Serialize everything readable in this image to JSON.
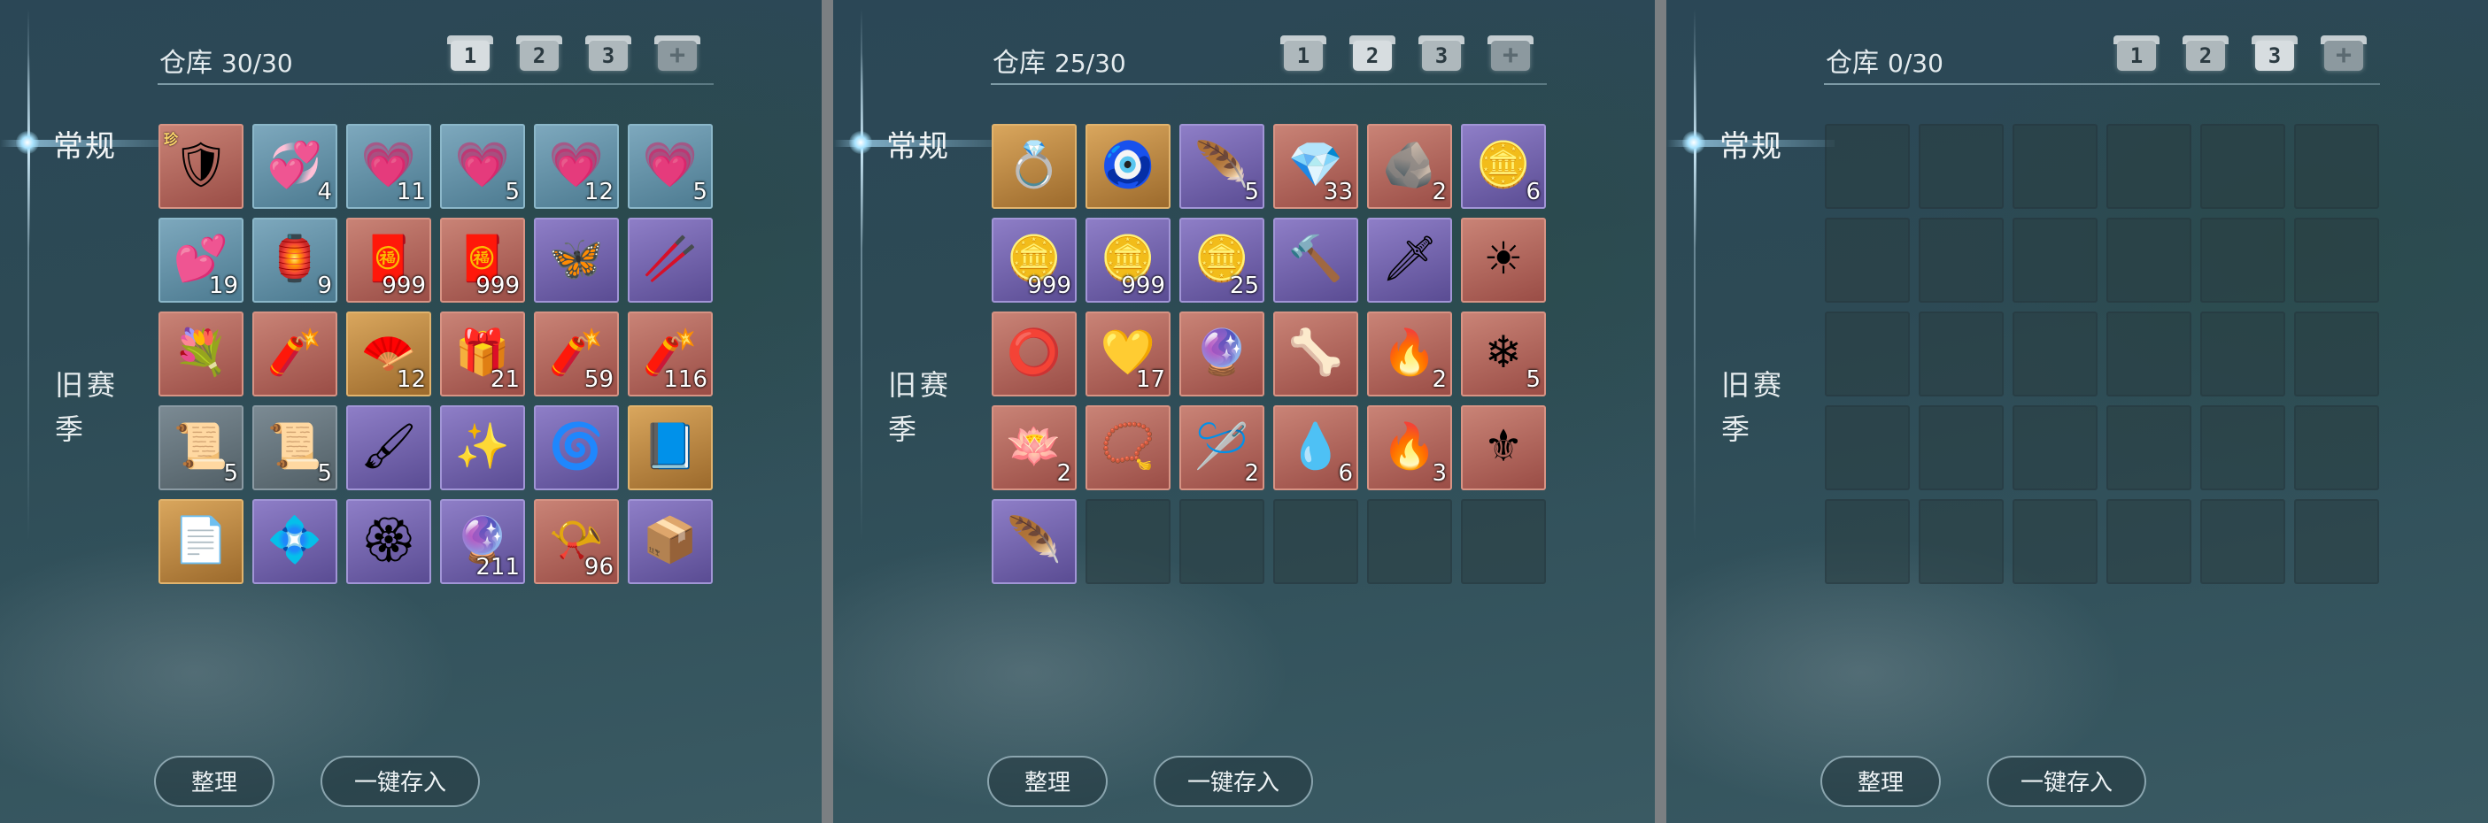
{
  "panels": [
    {
      "title": "仓库",
      "count": "30/30",
      "active_page": 1,
      "pages": [
        "1",
        "2",
        "3",
        "+"
      ],
      "tabs": {
        "general": "常规",
        "old_season": "旧赛季"
      },
      "buttons": {
        "sort": "整理",
        "store_all": "一键存入"
      },
      "slots": [
        {
          "rarity": "red",
          "icon": "armor-icon",
          "glyph": "🛡",
          "qty": "",
          "tag": "珍"
        },
        {
          "rarity": "blue",
          "icon": "sparkle-hearts-icon",
          "glyph": "💞",
          "qty": "4"
        },
        {
          "rarity": "blue",
          "icon": "heart-icon",
          "glyph": "💗",
          "qty": "11"
        },
        {
          "rarity": "blue",
          "icon": "heart-icon",
          "glyph": "💗",
          "qty": "5"
        },
        {
          "rarity": "blue",
          "icon": "heart-icon",
          "glyph": "💗",
          "qty": "12"
        },
        {
          "rarity": "blue",
          "icon": "heart-icon",
          "glyph": "💗",
          "qty": "5"
        },
        {
          "rarity": "blue",
          "icon": "small-hearts-icon",
          "glyph": "💕",
          "qty": "19"
        },
        {
          "rarity": "blue",
          "icon": "lantern-icon",
          "glyph": "🏮",
          "qty": "9"
        },
        {
          "rarity": "red",
          "icon": "gift-box-icon",
          "glyph": "🧧",
          "qty": "999"
        },
        {
          "rarity": "red",
          "icon": "gift-box-icon",
          "glyph": "🧧",
          "qty": "999"
        },
        {
          "rarity": "purple",
          "icon": "butterfly-icon",
          "glyph": "🦋",
          "qty": ""
        },
        {
          "rarity": "purple",
          "icon": "chopsticks-icon",
          "glyph": "🥢",
          "qty": ""
        },
        {
          "rarity": "red",
          "icon": "bouquet-icon",
          "glyph": "💐",
          "qty": ""
        },
        {
          "rarity": "red",
          "icon": "firecracker-icon",
          "glyph": "🧨",
          "qty": ""
        },
        {
          "rarity": "gold",
          "icon": "fan-icon",
          "glyph": "🪭",
          "qty": "12"
        },
        {
          "rarity": "red",
          "icon": "red-chest-icon",
          "glyph": "🎁",
          "qty": "21"
        },
        {
          "rarity": "red",
          "icon": "firecracker-bundle-icon",
          "glyph": "🧨",
          "qty": "59"
        },
        {
          "rarity": "red",
          "icon": "firecracker-roll-icon",
          "glyph": "🧨",
          "qty": "116"
        },
        {
          "rarity": "gray",
          "icon": "scroll-icon",
          "glyph": "📜",
          "qty": "5"
        },
        {
          "rarity": "gray",
          "icon": "scroll-icon",
          "glyph": "📜",
          "qty": "5"
        },
        {
          "rarity": "purple",
          "icon": "brush-icon",
          "glyph": "🖌",
          "qty": ""
        },
        {
          "rarity": "purple",
          "icon": "golden-flower-pin-icon",
          "glyph": "✨",
          "qty": ""
        },
        {
          "rarity": "purple",
          "icon": "purple-swirl-icon",
          "glyph": "🌀",
          "qty": ""
        },
        {
          "rarity": "gold",
          "icon": "book-icon",
          "glyph": "📘",
          "qty": ""
        },
        {
          "rarity": "gold",
          "icon": "paper-icon",
          "glyph": "📄",
          "qty": ""
        },
        {
          "rarity": "purple",
          "icon": "blue-flowers-icon",
          "glyph": "💠",
          "qty": ""
        },
        {
          "rarity": "purple",
          "icon": "amulet-icon",
          "glyph": "🏵",
          "qty": ""
        },
        {
          "rarity": "purple",
          "icon": "pink-orb-icon",
          "glyph": "🔮",
          "qty": "211"
        },
        {
          "rarity": "red",
          "icon": "golden-scroll-icon",
          "glyph": "📯",
          "qty": "96"
        },
        {
          "rarity": "purple",
          "icon": "green-box-icon",
          "glyph": "📦",
          "qty": ""
        }
      ]
    },
    {
      "title": "仓库",
      "count": "25/30",
      "active_page": 2,
      "pages": [
        "1",
        "2",
        "3",
        "+"
      ],
      "tabs": {
        "general": "常规",
        "old_season": "旧赛季"
      },
      "buttons": {
        "sort": "整理",
        "store_all": "一键存入"
      },
      "slots": [
        {
          "rarity": "gold",
          "icon": "jade-ring-icon",
          "glyph": "💍",
          "qty": ""
        },
        {
          "rarity": "gold",
          "icon": "jade-pendant-icon",
          "glyph": "🧿",
          "qty": ""
        },
        {
          "rarity": "purple",
          "icon": "feather-icon",
          "glyph": "🪶",
          "qty": "5"
        },
        {
          "rarity": "red",
          "icon": "pink-gem-icon",
          "glyph": "💎",
          "qty": "33"
        },
        {
          "rarity": "red",
          "icon": "ore-icon",
          "glyph": "🪨",
          "qty": "2"
        },
        {
          "rarity": "purple",
          "icon": "gold-coin-icon",
          "glyph": "🪙",
          "qty": "6"
        },
        {
          "rarity": "purple",
          "icon": "bronze-coin-icon",
          "glyph": "🪙",
          "qty": "999"
        },
        {
          "rarity": "purple",
          "icon": "bronze-coin-icon",
          "glyph": "🪙",
          "qty": "999"
        },
        {
          "rarity": "purple",
          "icon": "bronze-coin-icon",
          "glyph": "🪙",
          "qty": "25"
        },
        {
          "rarity": "purple",
          "icon": "hammer-icon",
          "glyph": "🔨",
          "qty": ""
        },
        {
          "rarity": "purple",
          "icon": "dagger-icon",
          "glyph": "🗡",
          "qty": ""
        },
        {
          "rarity": "red",
          "icon": "sun-medallion-icon",
          "glyph": "☀",
          "qty": ""
        },
        {
          "rarity": "red",
          "icon": "purple-ring-icon",
          "glyph": "⭕",
          "qty": ""
        },
        {
          "rarity": "red",
          "icon": "yellow-crystal-icon",
          "glyph": "💛",
          "qty": "17"
        },
        {
          "rarity": "red",
          "icon": "purple-orb-ring-icon",
          "glyph": "🔮",
          "qty": ""
        },
        {
          "rarity": "red",
          "icon": "claw-icon",
          "glyph": "🦴",
          "qty": ""
        },
        {
          "rarity": "red",
          "icon": "fire-shard-icon",
          "glyph": "🔥",
          "qty": "2"
        },
        {
          "rarity": "red",
          "icon": "ice-shard-icon",
          "glyph": "❄",
          "qty": "5"
        },
        {
          "rarity": "red",
          "icon": "lotus-icon",
          "glyph": "🪷",
          "qty": "2"
        },
        {
          "rarity": "red",
          "icon": "prayer-beads-icon",
          "glyph": "📿",
          "qty": ""
        },
        {
          "rarity": "red",
          "icon": "needle-icon",
          "glyph": "🪡",
          "qty": "2"
        },
        {
          "rarity": "red",
          "icon": "water-drop-icon",
          "glyph": "💧",
          "qty": "6"
        },
        {
          "rarity": "red",
          "icon": "flame-icon",
          "glyph": "🔥",
          "qty": "3"
        },
        {
          "rarity": "red",
          "icon": "spiked-item-icon",
          "glyph": "⚜",
          "qty": ""
        },
        {
          "rarity": "purple",
          "icon": "purple-wisp-icon",
          "glyph": "🪶",
          "qty": ""
        },
        {
          "rarity": "empty"
        },
        {
          "rarity": "empty"
        },
        {
          "rarity": "empty"
        },
        {
          "rarity": "empty"
        },
        {
          "rarity": "empty"
        }
      ]
    },
    {
      "title": "仓库",
      "count": "0/30",
      "active_page": 3,
      "pages": [
        "1",
        "2",
        "3",
        "+"
      ],
      "tabs": {
        "general": "常规",
        "old_season": "旧赛季"
      },
      "buttons": {
        "sort": "整理",
        "store_all": "一键存入"
      },
      "slots": [
        {
          "rarity": "empty"
        },
        {
          "rarity": "empty"
        },
        {
          "rarity": "empty"
        },
        {
          "rarity": "empty"
        },
        {
          "rarity": "empty"
        },
        {
          "rarity": "empty"
        },
        {
          "rarity": "empty"
        },
        {
          "rarity": "empty"
        },
        {
          "rarity": "empty"
        },
        {
          "rarity": "empty"
        },
        {
          "rarity": "empty"
        },
        {
          "rarity": "empty"
        },
        {
          "rarity": "empty"
        },
        {
          "rarity": "empty"
        },
        {
          "rarity": "empty"
        },
        {
          "rarity": "empty"
        },
        {
          "rarity": "empty"
        },
        {
          "rarity": "empty"
        },
        {
          "rarity": "empty"
        },
        {
          "rarity": "empty"
        },
        {
          "rarity": "empty"
        },
        {
          "rarity": "empty"
        },
        {
          "rarity": "empty"
        },
        {
          "rarity": "empty"
        },
        {
          "rarity": "empty"
        },
        {
          "rarity": "empty"
        },
        {
          "rarity": "empty"
        },
        {
          "rarity": "empty"
        },
        {
          "rarity": "empty"
        },
        {
          "rarity": "empty"
        }
      ]
    }
  ]
}
